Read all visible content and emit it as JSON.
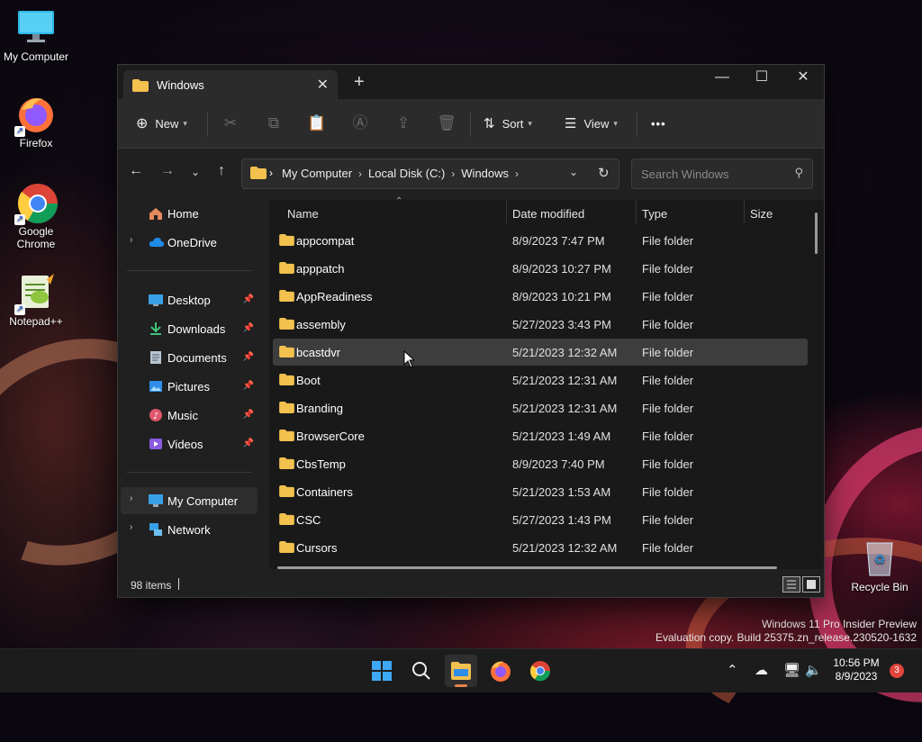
{
  "desktop": {
    "icons": [
      {
        "label": "My Computer"
      },
      {
        "label": "Firefox"
      },
      {
        "label": "Google Chrome"
      },
      {
        "label": "Notepad++"
      }
    ],
    "recycle_bin": "Recycle Bin",
    "watermark_line1": "Windows 11 Pro Insider Preview",
    "watermark_line2": "Evaluation copy. Build 25375.zn_release.230520-1632"
  },
  "explorer": {
    "tab_title": "Windows",
    "toolbar": {
      "new_label": "New",
      "sort_label": "Sort",
      "view_label": "View",
      "more_label": "•••"
    },
    "breadcrumb": [
      "My Computer",
      "Local Disk (C:)",
      "Windows"
    ],
    "search_placeholder": "Search Windows",
    "sidebar": {
      "home": "Home",
      "onedrive": "OneDrive",
      "desktop": "Desktop",
      "downloads": "Downloads",
      "documents": "Documents",
      "pictures": "Pictures",
      "music": "Music",
      "videos": "Videos",
      "my_computer": "My Computer",
      "network": "Network"
    },
    "columns": {
      "name": "Name",
      "date": "Date modified",
      "type": "Type",
      "size": "Size"
    },
    "files": [
      {
        "name": "appcompat",
        "date": "8/9/2023 7:47 PM",
        "type": "File folder"
      },
      {
        "name": "apppatch",
        "date": "8/9/2023 10:27 PM",
        "type": "File folder"
      },
      {
        "name": "AppReadiness",
        "date": "8/9/2023 10:21 PM",
        "type": "File folder"
      },
      {
        "name": "assembly",
        "date": "5/27/2023 3:43 PM",
        "type": "File folder"
      },
      {
        "name": "bcastdvr",
        "date": "5/21/2023 12:32 AM",
        "type": "File folder"
      },
      {
        "name": "Boot",
        "date": "5/21/2023 12:31 AM",
        "type": "File folder"
      },
      {
        "name": "Branding",
        "date": "5/21/2023 12:31 AM",
        "type": "File folder"
      },
      {
        "name": "BrowserCore",
        "date": "5/21/2023 1:49 AM",
        "type": "File folder"
      },
      {
        "name": "CbsTemp",
        "date": "8/9/2023 7:40 PM",
        "type": "File folder"
      },
      {
        "name": "Containers",
        "date": "5/21/2023 1:53 AM",
        "type": "File folder"
      },
      {
        "name": "CSC",
        "date": "5/27/2023 1:43 PM",
        "type": "File folder"
      },
      {
        "name": "Cursors",
        "date": "5/21/2023 12:32 AM",
        "type": "File folder"
      }
    ],
    "status_count": "98 items"
  },
  "taskbar": {
    "time": "10:56 PM",
    "date": "8/9/2023",
    "notification_count": "3"
  },
  "colors": {
    "accent": "#e8834a",
    "folder": "#f2c14e",
    "hover_row": "#3d3d3d"
  }
}
